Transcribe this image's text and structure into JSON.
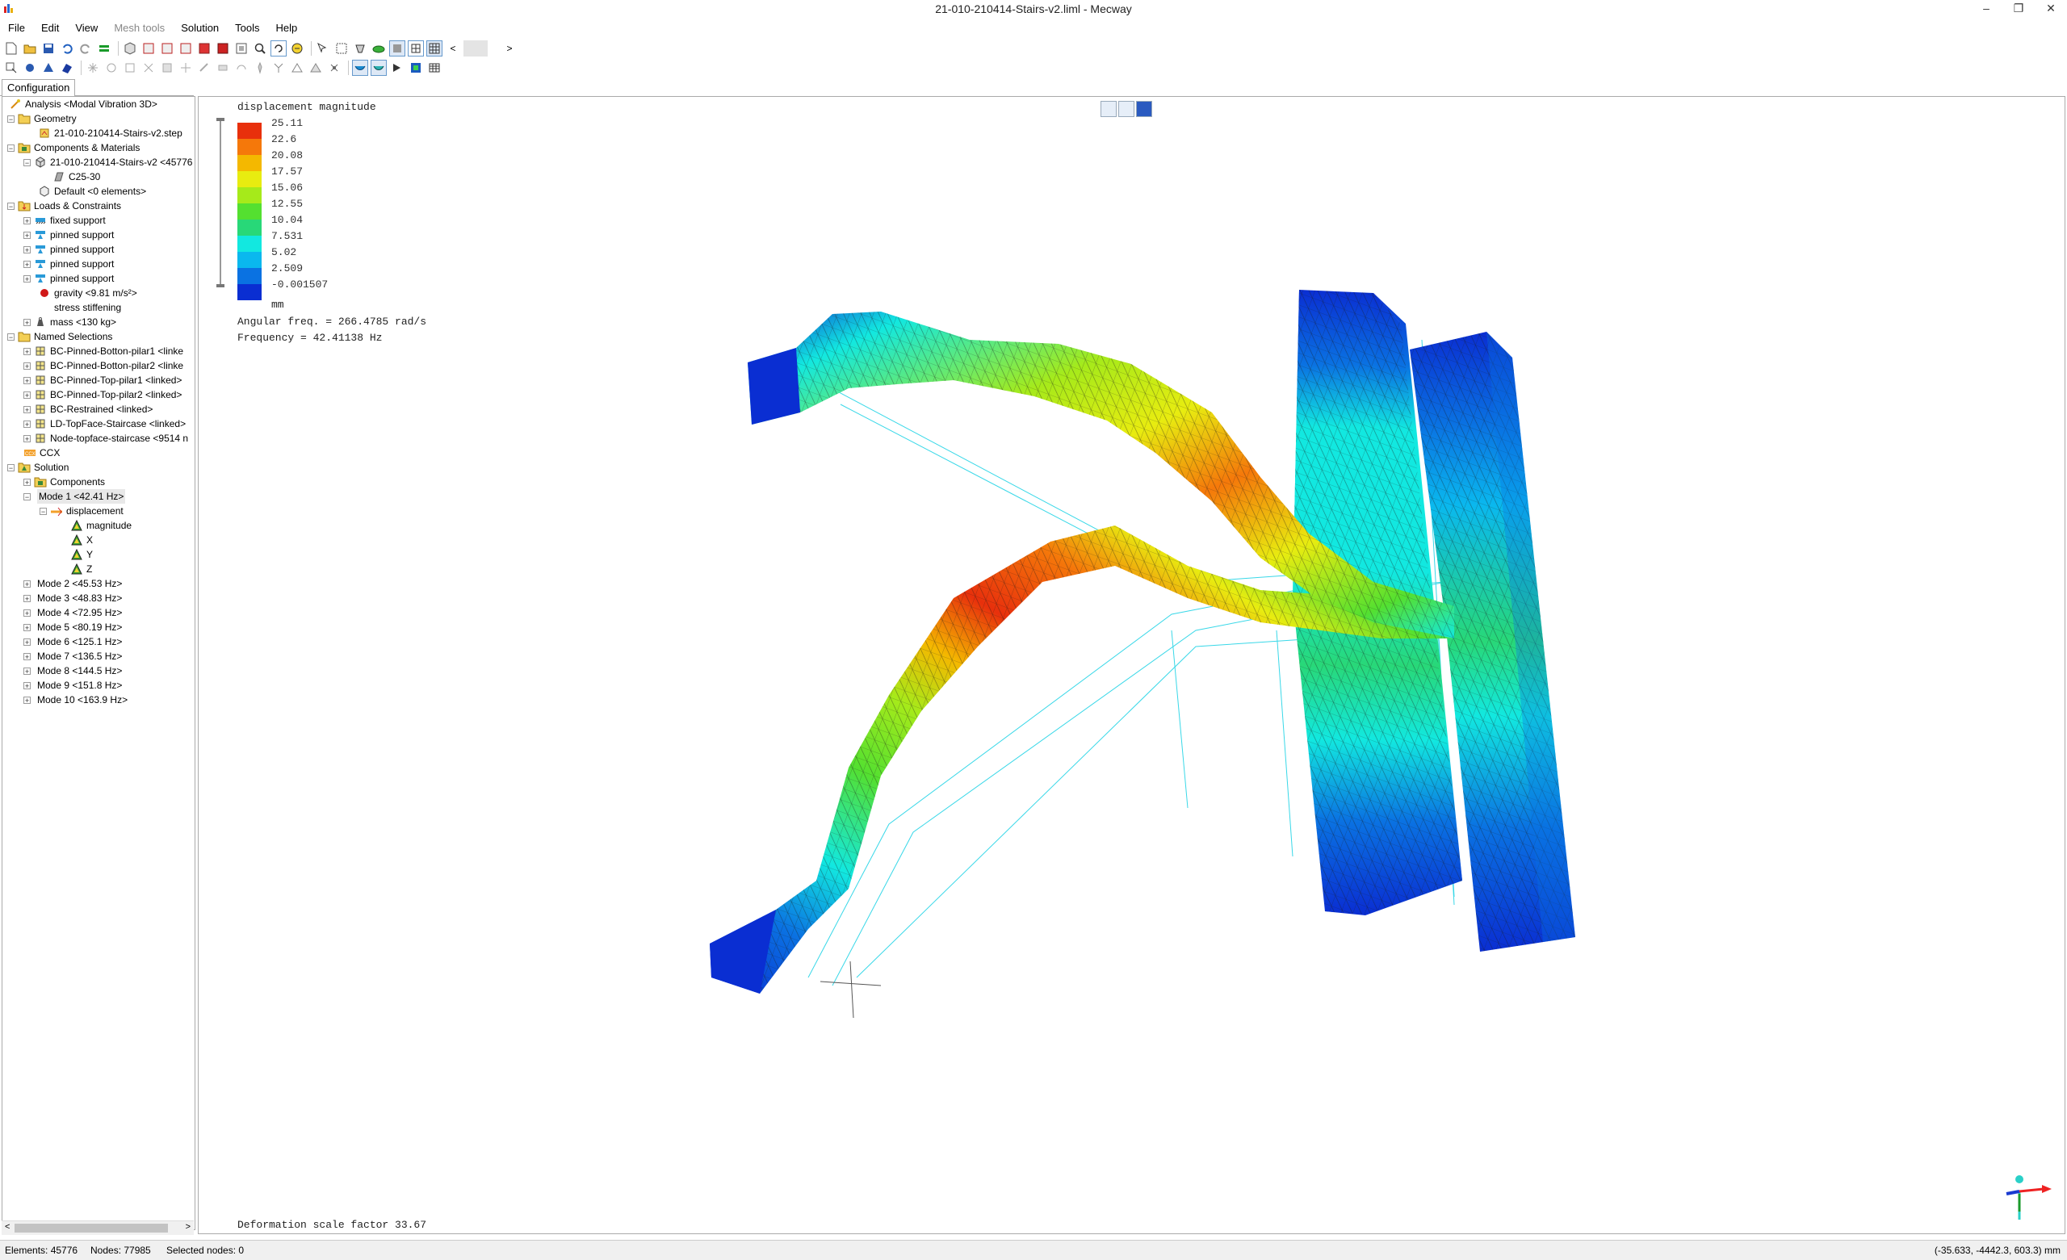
{
  "window": {
    "title": "21-010-210414-Stairs-v2.liml - Mecway",
    "minimize": "–",
    "restore": "❐",
    "close": "✕"
  },
  "menu": [
    {
      "label": "File",
      "enabled": true
    },
    {
      "label": "Edit",
      "enabled": true
    },
    {
      "label": "View",
      "enabled": true
    },
    {
      "label": "Mesh tools",
      "enabled": false
    },
    {
      "label": "Solution",
      "enabled": true
    },
    {
      "label": "Tools",
      "enabled": true
    },
    {
      "label": "Help",
      "enabled": true
    }
  ],
  "config_tab": "Configuration",
  "tree": [
    {
      "label": "Analysis <Modal Vibration 3D>",
      "icon": "analysis-icon"
    },
    {
      "label": "Geometry",
      "icon": "folder-icon"
    },
    {
      "label": "21-010-210414-Stairs-v2.step",
      "icon": "step-file-icon"
    },
    {
      "label": "Components & Materials",
      "icon": "components-icon"
    },
    {
      "label": "21-010-210414-Stairs-v2 <45776",
      "icon": "component-icon"
    },
    {
      "label": "C25-30",
      "icon": "material-icon"
    },
    {
      "label": "Default <0 elements>",
      "icon": "component-icon"
    },
    {
      "label": "Loads & Constraints",
      "icon": "loads-icon"
    },
    {
      "label": "fixed support",
      "icon": "fixed-support-icon"
    },
    {
      "label": "pinned support",
      "icon": "pinned-support-icon"
    },
    {
      "label": "pinned support",
      "icon": "pinned-support-icon"
    },
    {
      "label": "pinned support",
      "icon": "pinned-support-icon"
    },
    {
      "label": "pinned support",
      "icon": "pinned-support-icon"
    },
    {
      "label": "gravity <9.81 m/s²>",
      "icon": "gravity-icon"
    },
    {
      "label": "stress stiffening",
      "icon": ""
    },
    {
      "label": "mass <130 kg>",
      "icon": "mass-icon"
    },
    {
      "label": "Named Selections",
      "icon": "folder-icon"
    },
    {
      "label": "BC-Pinned-Botton-pilar1 <linke",
      "icon": "named-selection-icon"
    },
    {
      "label": "BC-Pinned-Botton-pilar2 <linke",
      "icon": "named-selection-icon"
    },
    {
      "label": "BC-Pinned-Top-pilar1 <linked>",
      "icon": "named-selection-icon"
    },
    {
      "label": "BC-Pinned-Top-pilar2 <linked>",
      "icon": "named-selection-icon"
    },
    {
      "label": "BC-Restrained <linked>",
      "icon": "named-selection-icon"
    },
    {
      "label": "LD-TopFace-Staircase <linked>",
      "icon": "named-selection-icon"
    },
    {
      "label": "Node-topface-staircase <9514 n",
      "icon": "named-selection-icon"
    },
    {
      "label": "CCX",
      "icon": "ccx-icon"
    },
    {
      "label": "Solution",
      "icon": "solution-icon"
    },
    {
      "label": "Components",
      "icon": "components-icon"
    },
    {
      "label": "Mode 1 <42.41 Hz>",
      "icon": ""
    },
    {
      "label": "displacement",
      "icon": "displacement-icon"
    },
    {
      "label": "magnitude",
      "icon": "result-icon"
    },
    {
      "label": "X",
      "icon": "result-icon"
    },
    {
      "label": "Y",
      "icon": "result-icon"
    },
    {
      "label": "Z",
      "icon": "result-icon"
    },
    {
      "label": "Mode 2 <45.53 Hz>",
      "icon": ""
    },
    {
      "label": "Mode 3 <48.83 Hz>",
      "icon": ""
    },
    {
      "label": "Mode 4 <72.95 Hz>",
      "icon": ""
    },
    {
      "label": "Mode 5 <80.19 Hz>",
      "icon": ""
    },
    {
      "label": "Mode 6 <125.1 Hz>",
      "icon": ""
    },
    {
      "label": "Mode 7 <136.5 Hz>",
      "icon": ""
    },
    {
      "label": "Mode 8 <144.5 Hz>",
      "icon": ""
    },
    {
      "label": "Mode 9 <151.8 Hz>",
      "icon": ""
    },
    {
      "label": "Mode 10 <163.9 Hz>",
      "icon": ""
    }
  ],
  "viewport": {
    "legend_title": "displacement magnitude",
    "legend_values": [
      "25.11",
      "22.6",
      "20.08",
      "17.57",
      "15.06",
      "12.55",
      "10.04",
      "7.531",
      "5.02",
      "2.509",
      "-0.001507"
    ],
    "legend_colors": [
      "#e8300c",
      "#f5780a",
      "#f4b800",
      "#e8ec10",
      "#a6ea1a",
      "#54e030",
      "#28d878",
      "#12e8e0",
      "#0ab8ee",
      "#0a72e2",
      "#0a2ed2"
    ],
    "unit": "mm",
    "angular_freq": "Angular freq. = 266.4785 rad/s",
    "frequency": "Frequency = 42.41138 Hz",
    "deformation": "Deformation scale factor 33.67"
  },
  "status": {
    "elements": "Elements: 45776",
    "nodes": "Nodes: 77985",
    "selected": "Selected nodes: 0",
    "coords": "(-35.633, -4442.3, 603.3) mm"
  }
}
